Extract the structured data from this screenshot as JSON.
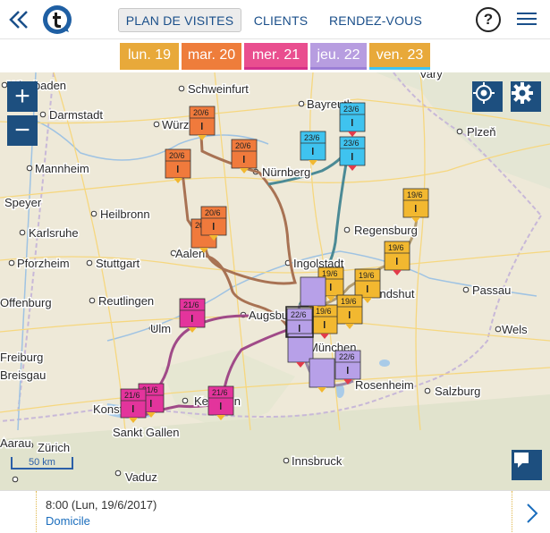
{
  "nav": {
    "tabs": [
      {
        "label": "PLAN DE VISITES",
        "active": true
      },
      {
        "label": "CLIENTS",
        "active": false
      },
      {
        "label": "RENDEZ-VOUS",
        "active": false
      }
    ],
    "help_label": "?"
  },
  "days": [
    {
      "label": "lun. 19",
      "color": "#e8a93a",
      "active": true
    },
    {
      "label": "mar. 20",
      "color": "#ee7d3b",
      "active": false
    },
    {
      "label": "mer. 21",
      "color": "#e94e8f",
      "active": false
    },
    {
      "label": "jeu. 22",
      "color": "#b79de0",
      "active": false
    },
    {
      "label": "ven. 23",
      "color": "#e8a93a",
      "active": false
    }
  ],
  "map": {
    "zoom_in": "+",
    "zoom_out": "−",
    "scale_label": "50 km",
    "cities": [
      "Wiesbaden",
      "Schweinfurt",
      "Bayreuth",
      "Vary",
      "Darmstadt",
      "Würzburg",
      "Plzeň",
      "Mannheim",
      "Nürnberg",
      "Speyer",
      "Heilbronn",
      "Regensburg",
      "Karlsruhe",
      "Aalen",
      "Pforzheim",
      "Stuttgart",
      "Ingolstadt",
      "Landshut",
      "Passau",
      "Offenburg",
      "Reutlingen",
      "Ulm",
      "Augsburg",
      "Wels",
      "München",
      "Freiburg",
      "Breisgau",
      "Rosenheim",
      "Salzburg",
      "Kempten",
      "Konstanz",
      "Sankt Gallen",
      "Zürich",
      "Aarau",
      "Innsbruck",
      "Vaduz"
    ],
    "pins": [
      {
        "label": "20/6",
        "color": "#f07a3c"
      },
      {
        "label": "20/6",
        "color": "#f07a3c"
      },
      {
        "label": "20/6",
        "color": "#f07a3c"
      },
      {
        "label": "20/6",
        "color": "#f07a3c"
      },
      {
        "label": "20/6",
        "color": "#f07a3c"
      },
      {
        "label": "23/6",
        "color": "#3fc3ef"
      },
      {
        "label": "23/6",
        "color": "#3fc3ef"
      },
      {
        "label": "23/6",
        "color": "#3fc3ef"
      },
      {
        "label": "19/6",
        "color": "#f2b830"
      },
      {
        "label": "19/6",
        "color": "#f2b830"
      },
      {
        "label": "19/6",
        "color": "#f2b830"
      },
      {
        "label": "19/6",
        "color": "#f2b830"
      },
      {
        "label": "19/6",
        "color": "#f2b830"
      },
      {
        "label": "19/6",
        "color": "#f2b830"
      },
      {
        "label": "22/6",
        "color": "#b7a0e8"
      },
      {
        "label": "22/6",
        "color": "#b7a0e8"
      },
      {
        "label": "21/6",
        "color": "#e3349c"
      },
      {
        "label": "21/6",
        "color": "#e3349c"
      },
      {
        "label": "21/6",
        "color": "#e3349c"
      },
      {
        "label": "21/6",
        "color": "#e3349c"
      },
      {
        "label": "22/6",
        "color": "#b7a0e8"
      }
    ]
  },
  "footer": {
    "time": "8:00 (Lun, 19/6/2017)",
    "place": "Domicile"
  }
}
